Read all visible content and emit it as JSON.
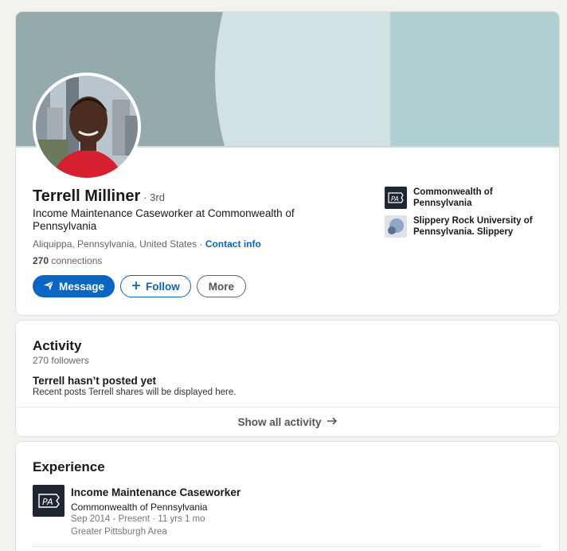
{
  "profile": {
    "name": "Terrell Milliner",
    "degree": "· 3rd",
    "headline": "Income Maintenance Caseworker at Commonwealth of Pennsylvania",
    "location": "Aliquippa, Pennsylvania, United States",
    "location_separator": " · ",
    "contact_info": "Contact info",
    "connections_count": "270",
    "connections_label": " connections",
    "buttons": {
      "message": "Message",
      "follow": "Follow",
      "more": "More"
    },
    "affiliations": [
      {
        "name": "Commonwealth of Pennsylvania"
      },
      {
        "name": "Slippery Rock University of Pennsylvania. Slippery"
      }
    ]
  },
  "activity": {
    "title": "Activity",
    "followers": "270 followers",
    "empty_title": "Terrell hasn’t posted yet",
    "empty_subtitle": "Recent posts Terrell shares will be displayed here.",
    "show_all": "Show all activity"
  },
  "experience": {
    "title": "Experience",
    "items": [
      {
        "title": "Income Maintenance Caseworker",
        "company": "Commonwealth of Pennsylvania",
        "dates": "Sep 2014 - Present · 11 yrs 1 mo",
        "location": "Greater Pittsburgh Area"
      }
    ]
  },
  "colors": {
    "primary": "#0a66c2",
    "page_background": "#f4f2ee",
    "banner": "#94aaad"
  },
  "icons": [
    "paper-plane-icon",
    "plus-icon",
    "arrow-right-icon",
    "pa-logo-icon",
    "sru-logo-icon"
  ]
}
